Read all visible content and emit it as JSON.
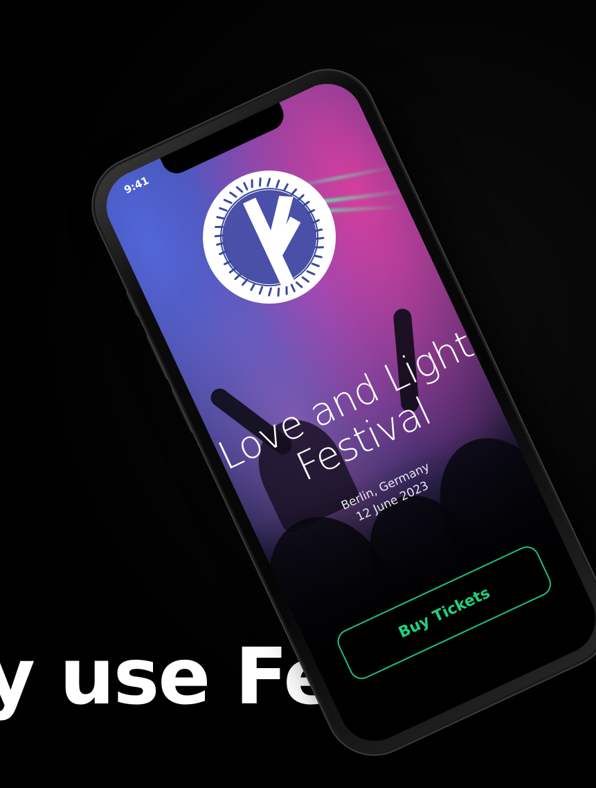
{
  "marketing": {
    "headline": "y use Fehu"
  },
  "phone": {
    "status_bar": {
      "time": "9:41"
    },
    "event": {
      "title_line1": "Love and Light",
      "title_line2": "Festival",
      "location": "Berlin, Germany",
      "date": "12 June 2023",
      "buy_button_label": "Buy Tickets"
    },
    "logo_icon": "fehu-rune-circle-logo-icon"
  },
  "colors": {
    "background": "#000000",
    "accent_green": "#22d07f",
    "button_border": "#1fc27a",
    "text_white": "#ffffff"
  }
}
